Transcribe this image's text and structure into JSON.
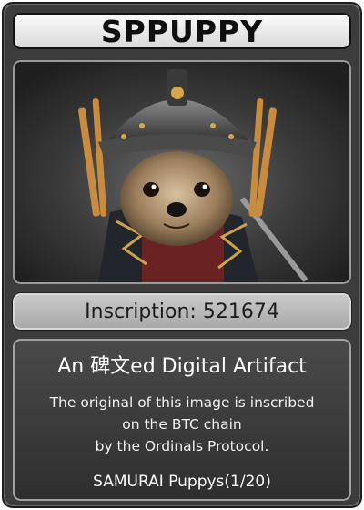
{
  "card": {
    "title": "SPPUPPY",
    "inscription": "Inscription: 521674",
    "artwork_icon": "samurai-puppy-image",
    "info": {
      "heading": "An 碑文ed Digital Artifact",
      "lines": [
        "The original of this image is inscribed",
        "on the BTC chain",
        "by the Ordinals Protocol."
      ],
      "footer": "SAMURAI Puppys(1/20)"
    }
  },
  "colors": {
    "card_background": "#3c3c3c",
    "title_bar": "#e6e6e6",
    "inscription_bar": "#b8b8b8",
    "info_text": "#f2f2f2"
  }
}
